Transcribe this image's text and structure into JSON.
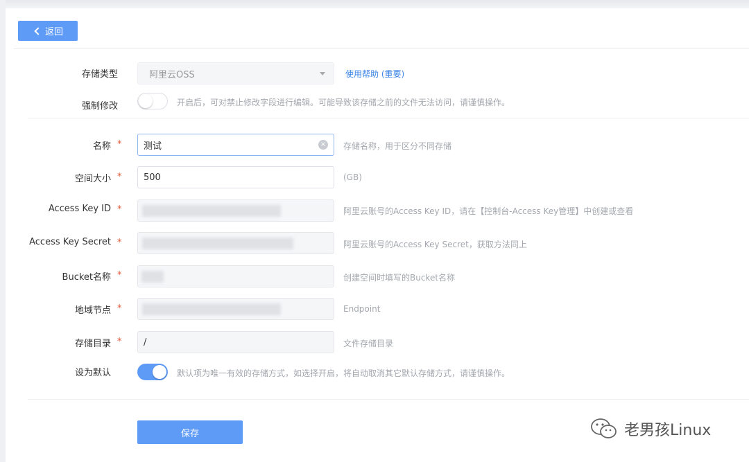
{
  "header": {
    "back_label": "返回"
  },
  "storage_type": {
    "label": "存储类型",
    "value": "阿里云OSS",
    "help_link": "使用帮助 (重要)"
  },
  "force_edit": {
    "label": "强制修改",
    "enabled": false,
    "hint": "开启后，可对禁止修改字段进行编辑。可能导致该存储之前的文件无法访问，请谨慎操作。"
  },
  "fields": {
    "name": {
      "label": "名称",
      "required": "*",
      "value": "测试",
      "hint": "存储名称，用于区分不同存储"
    },
    "capacity": {
      "label": "空间大小",
      "required": "*",
      "value": "500",
      "hint": "(GB)"
    },
    "access_key_id": {
      "label": "Access Key ID",
      "required": "*",
      "value": "",
      "hint": "阿里云账号的Access Key ID，请在【控制台-Access Key管理】中创建或查看"
    },
    "access_key_secret": {
      "label": "Access Key Secret",
      "required": "*",
      "value": "",
      "hint": "阿里云账号的Access Key Secret，获取方法同上"
    },
    "bucket": {
      "label": "Bucket名称",
      "required": "*",
      "value": "",
      "hint": "创建空间时填写的Bucket名称"
    },
    "endpoint": {
      "label": "地域节点",
      "required": "*",
      "value": "",
      "hint": "Endpoint"
    },
    "directory": {
      "label": "存储目录",
      "required": "*",
      "value": "/",
      "hint": "文件存储目录"
    }
  },
  "default": {
    "label": "设为默认",
    "enabled": true,
    "hint": "默认项为唯一有效的存储方式，如选择开启，将自动取消其它默认存储方式，请谨慎操作。"
  },
  "save_label": "保存",
  "watermark": "老男孩Linux",
  "colors": {
    "accent": "#5e9bf7",
    "link": "#3d86e8",
    "required": "#e05a3a"
  }
}
